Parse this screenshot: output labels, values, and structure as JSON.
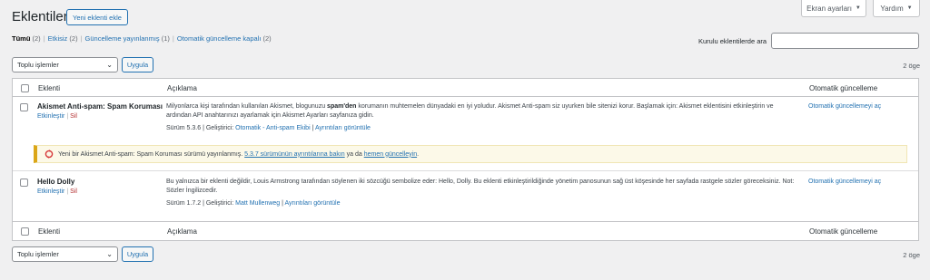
{
  "header": {
    "screen_options": "Ekran ayarları",
    "help": "Yardım",
    "title": "Eklentiler",
    "add_new": "Yeni eklenti ekle"
  },
  "filters": [
    {
      "label": "Tümü",
      "count": "(2)"
    },
    {
      "label": "Etkisiz",
      "count": "(2)"
    },
    {
      "label": "Güncelleme yayınlanmış",
      "count": "(1)"
    },
    {
      "label": "Otomatik güncelleme kapalı",
      "count": "(2)"
    }
  ],
  "search": {
    "label": "Kurulu eklentilerde ara",
    "value": ""
  },
  "bulk": {
    "select_label": "Toplu işlemler",
    "apply": "Uygula",
    "count": "2 öge"
  },
  "columns": {
    "name": "Eklenti",
    "desc": "Açıklama",
    "auto": "Otomatik güncelleme"
  },
  "plugins": [
    {
      "name": "Akismet Anti-spam: Spam Koruması",
      "activate": "Etkinleştir",
      "delete": "Sil",
      "desc_pre": "Milyonlarca kişi tarafından kullanılan Akismet, blogunuzu ",
      "desc_bold": "spam'den",
      "desc_post": " korumanın muhtemelen dünyadaki en iyi yoludur. Akismet Anti-spam siz uyurken bile sitenizi korur. Başlamak için: Akismet eklentisini etkinleştirin ve ardından API anahtarınızı ayarlamak için Akismet Ayarları sayfanıza gidin.",
      "version": "Sürüm 5.3.6",
      "dev_label": "Geliştirici:",
      "developer": "Otomatik - Anti-spam Ekibi",
      "details": "Ayrıntıları görüntüle",
      "auto": "Otomatik güncellemeyi aç"
    },
    {
      "name": "Hello Dolly",
      "activate": "Etkinleştir",
      "delete": "Sil",
      "desc": "Bu yalnızca bir eklenti değildir, Louis Armstrong tarafından söylenen iki sözcüğü sembolize eder: Hello, Dolly. Bu eklenti etkinleştirildiğinde yönetim panosunun sağ üst köşesinde her sayfada rastgele sözler göreceksiniz. Not: Sözler İngilizcedir.",
      "version": "Sürüm 1.7.2",
      "dev_label": "Geliştirici:",
      "developer": "Matt Mullenweg",
      "details": "Ayrıntıları görüntüle",
      "auto": "Otomatik güncellemeyi aç"
    }
  ],
  "update_notice": {
    "text": "Yeni bir Akismet Anti-spam: Spam Koruması sürümü yayınlanmış.",
    "link1": "5.3.7 sürümünün ayrıntılarına bakın",
    "mid": "ya da",
    "link2": "hemen güncelleyin",
    "end": "."
  },
  "colors": {
    "accent": "#2271b1",
    "delete": "#b32d2e",
    "notice_border": "#dba617",
    "notice_bg": "#fcf9e8"
  }
}
